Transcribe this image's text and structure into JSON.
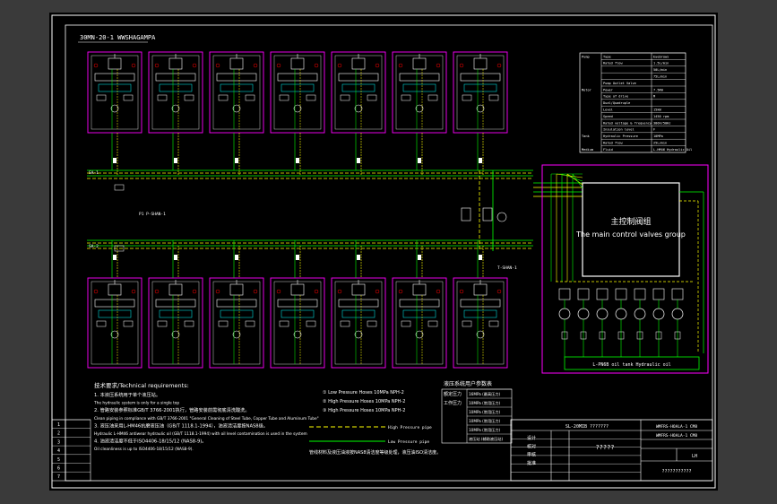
{
  "title_block_header": "30MN-20-1 WWSHAGAMPA",
  "main_group": {
    "zh": "主控制阀组",
    "en": "The main control valves group"
  },
  "pump_station_label": "L-PN6B oil tank Hydraulic oil",
  "upper_valve_count": 7,
  "lower_valve_count": 7,
  "bus_labels": {
    "upper_left": "SA-1",
    "lower_left": "SA-2",
    "upper_note": "P1 P-SHAN-1",
    "lower_note": "T-SHAN-1"
  },
  "spec_table": {
    "rows": [
      [
        "Pump",
        "Type",
        "Eyebrows"
      ],
      [
        "",
        "Rated flow",
        "1.5L/min"
      ],
      [
        "",
        "",
        "50L/min"
      ],
      [
        "",
        "",
        "75L/min"
      ],
      [
        "",
        "Pump Outlet Valve",
        ""
      ],
      [
        "Motor",
        "Power",
        "7.5KW"
      ],
      [
        "",
        "Type of drive",
        "M"
      ],
      [
        "",
        "Dual/Quadruple",
        ""
      ],
      [
        "",
        "Level",
        "15kW"
      ],
      [
        "",
        "Speed",
        "1450 rpm"
      ],
      [
        "",
        "Rated voltage & frequency",
        "380V/50Hz"
      ],
      [
        "",
        "Insulation level",
        "F"
      ],
      [
        "Tank",
        "Hydraulic Pressure",
        "10MPa"
      ],
      [
        "",
        "Rated flow",
        "25L/min"
      ],
      [
        "Medium",
        "Fluid",
        "L-HM46 Hydraulic Oil"
      ]
    ]
  },
  "tech_req": {
    "heading": "技术要求/Technical requirements:",
    "lines": [
      "1. 本液压系统用于单个液压站。",
      "The hydraulic system is only for a single top",
      "2. 管路安装参照标准GB/T 3766-2001执行，管路安装前需彻底清洗酸洗。",
      "Clean piping in compliance with GB/T 3766-2001 \"General Cleaning of Steel Tube, Copper Tube and Aluminum Tube\"",
      "3. 液压油采用L-HM46抗磨液压油（GB/T 1118.1-1994），油液清洁度按NAS8级。",
      "Hydraulic L-HM46 antiwear hydraulic oil (GB/T 1118.1-1994) with oil level contamination is used in the system",
      "4. 油液清洁度不低于ISO4406-18/15/12 (NAS8-9)。",
      "Oil cleanliness is up to ISO4406-18/15/12 (NAS8-9)."
    ]
  },
  "legend": {
    "items": [
      {
        "sym": "①",
        "label": "Low Pressure Hoses 10MPa  NPH-2"
      },
      {
        "sym": "②",
        "label": "High Pressure Hoses 10MPa  NPH-2"
      },
      {
        "sym": "③",
        "label": "High Pressure Hoses 10MPa  NPH-2"
      }
    ],
    "high_pressure": "High Pressure pipe",
    "low_pressure": "Low Pressure pipe",
    "note": "管线材料及液压油液按NAS8清洁度等级处理，液压油ISO清洁度。"
  },
  "param_table": {
    "title": "液压系统用户参数表",
    "rows": [
      [
        "额定压力",
        "16MPa (最高压力)"
      ],
      [
        "工作压力",
        "10MPa (常用压力)"
      ],
      [
        "",
        "10MPa (常用压力)"
      ],
      [
        "",
        "10MPa (常用压力)"
      ],
      [
        "",
        "10MPa (常用压力)"
      ],
      [
        "",
        "液压站 (辅助液压站)"
      ]
    ]
  },
  "title_block": {
    "drawing_no": "SL-20MIB ???????",
    "mid_title": "?????",
    "right_code1": "WMFRS-HOALA-1 CM8",
    "right_code2": "WMFRS-HOALA-1 CM8",
    "sheet": "LH",
    "bottom": "???????????",
    "row_labels": [
      "设计",
      "校对",
      "审核",
      "批准"
    ]
  },
  "revision_numbers": [
    "1",
    "2",
    "3",
    "4",
    "5",
    "6",
    "7"
  ],
  "colors": {
    "magenta": "#ff00ff",
    "green": "#00ff00",
    "yellow": "#ffff00",
    "white": "#ffffff",
    "cyan": "#00ffff",
    "red": "#ff0000"
  }
}
